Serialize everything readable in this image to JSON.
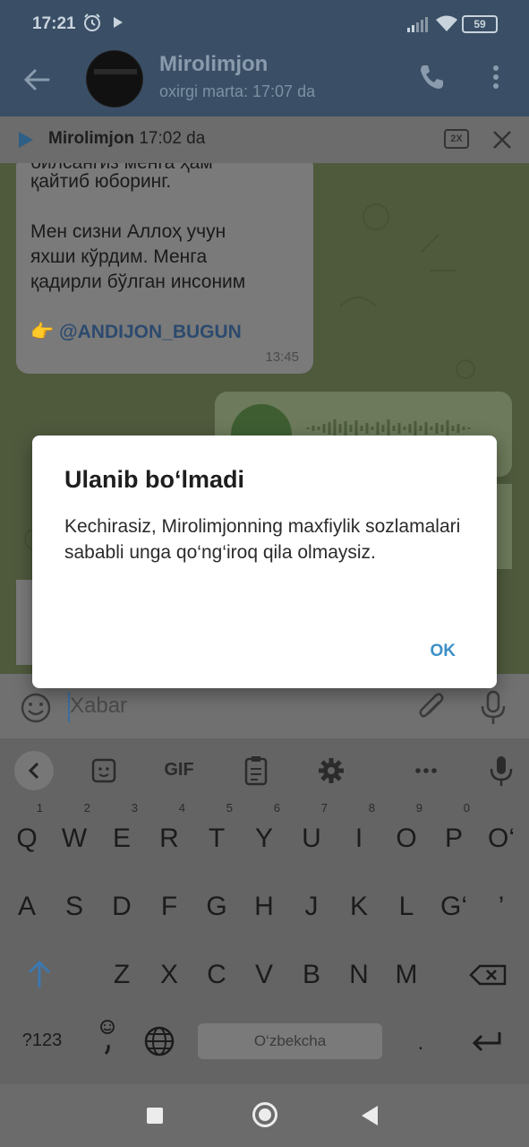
{
  "status_bar": {
    "time": "17:21",
    "battery": "59"
  },
  "header": {
    "contact_name": "Mirolimjon",
    "last_seen": "oxirgi marta: 17:07 da"
  },
  "player_bar": {
    "name": "Mirolimjon",
    "time": "17:02 da",
    "speed": "2X"
  },
  "messages": {
    "incoming": {
      "lines": [
        "билсангиз менга ҳам",
        "қайтиб юборинг.",
        "Мен сизни Аллоҳ учун",
        "яхши кўрдим. Менга",
        "қадирли бўлган инсоним"
      ],
      "link_emoji": "👉",
      "link": "@ANDIJON_BUGUN",
      "time": "13:45"
    }
  },
  "input": {
    "placeholder": "Xabar"
  },
  "keyboard": {
    "row1": [
      {
        "k": "Q",
        "h": "1"
      },
      {
        "k": "W",
        "h": "2"
      },
      {
        "k": "E",
        "h": "3"
      },
      {
        "k": "R",
        "h": "4"
      },
      {
        "k": "T",
        "h": "5"
      },
      {
        "k": "Y",
        "h": "6"
      },
      {
        "k": "U",
        "h": "7"
      },
      {
        "k": "I",
        "h": "8"
      },
      {
        "k": "O",
        "h": "9"
      },
      {
        "k": "P",
        "h": "0"
      },
      {
        "k": "O‘",
        "h": ""
      }
    ],
    "row2": [
      "A",
      "S",
      "D",
      "F",
      "G",
      "H",
      "J",
      "K",
      "L",
      "G‘",
      "’"
    ],
    "row3": [
      "Z",
      "X",
      "C",
      "V",
      "B",
      "N",
      "M"
    ],
    "toolbar": {
      "gif": "GIF"
    },
    "symbols_key": "?123",
    "space_label": "O‘zbekcha",
    "period": "."
  },
  "dialog": {
    "title": "Ulanib bo‘lmadi",
    "body": "Kechirasiz, Mirolimjonning maxfiylik sozlamalari sababli unga qo‘ng‘iroq qila olmaysiz.",
    "ok": "OK"
  }
}
